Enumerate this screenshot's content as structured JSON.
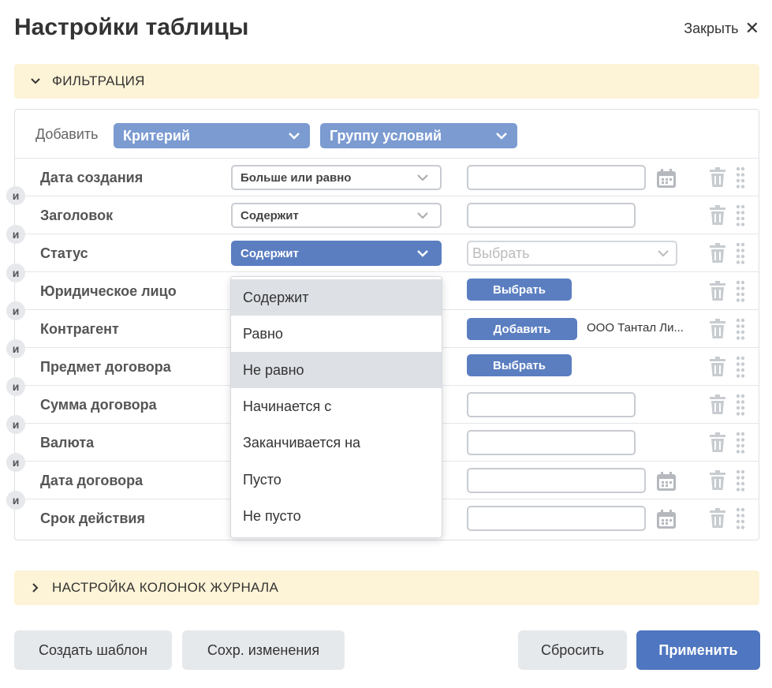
{
  "header": {
    "title": "Настройки таблицы",
    "close_label": "Закрыть"
  },
  "filter_section": {
    "title": "ФИЛЬТРАЦИЯ"
  },
  "add_bar": {
    "label": "Добавить",
    "criterion": "Критерий",
    "group": "Группу условий"
  },
  "conjunction": "и",
  "rows": [
    {
      "label": "Дата создания",
      "operator": "Больше или равно"
    },
    {
      "label": "Заголовок",
      "operator": "Содержит"
    },
    {
      "label": "Статус",
      "operator": "Содержит",
      "value_placeholder": "Выбрать"
    },
    {
      "label": "Юридическое лицо",
      "button": "Выбрать"
    },
    {
      "label": "Контрагент",
      "button": "Добавить",
      "chip": "ООО Тантал Ли..."
    },
    {
      "label": "Предмет договора",
      "button": "Выбрать"
    },
    {
      "label": "Сумма договора"
    },
    {
      "label": "Валюта"
    },
    {
      "label": "Дата договора"
    },
    {
      "label": "Срок действия"
    }
  ],
  "operator_menu": {
    "options": [
      "Содержит",
      "Равно",
      "Не равно",
      "Начинается с",
      "Заканчивается на",
      "Пусто",
      "Не пусто"
    ],
    "selected": "Содержит",
    "hovered": "Не равно"
  },
  "columns_section": {
    "title": "НАСТРОЙКА КОЛОНОК ЖУРНАЛА"
  },
  "footer": {
    "create_template": "Создать шаблон",
    "save_changes": "Сохр. изменения",
    "reset": "Сбросить",
    "apply": "Применить"
  },
  "colors": {
    "accent": "#4f76c0",
    "accent_light": "#7b9bd1",
    "section_bg": "#fdf3d6"
  },
  "icons": [
    "close-icon",
    "chevron-down-icon",
    "chevron-right-icon",
    "calendar-icon",
    "trash-icon",
    "drag-handle-icon"
  ]
}
